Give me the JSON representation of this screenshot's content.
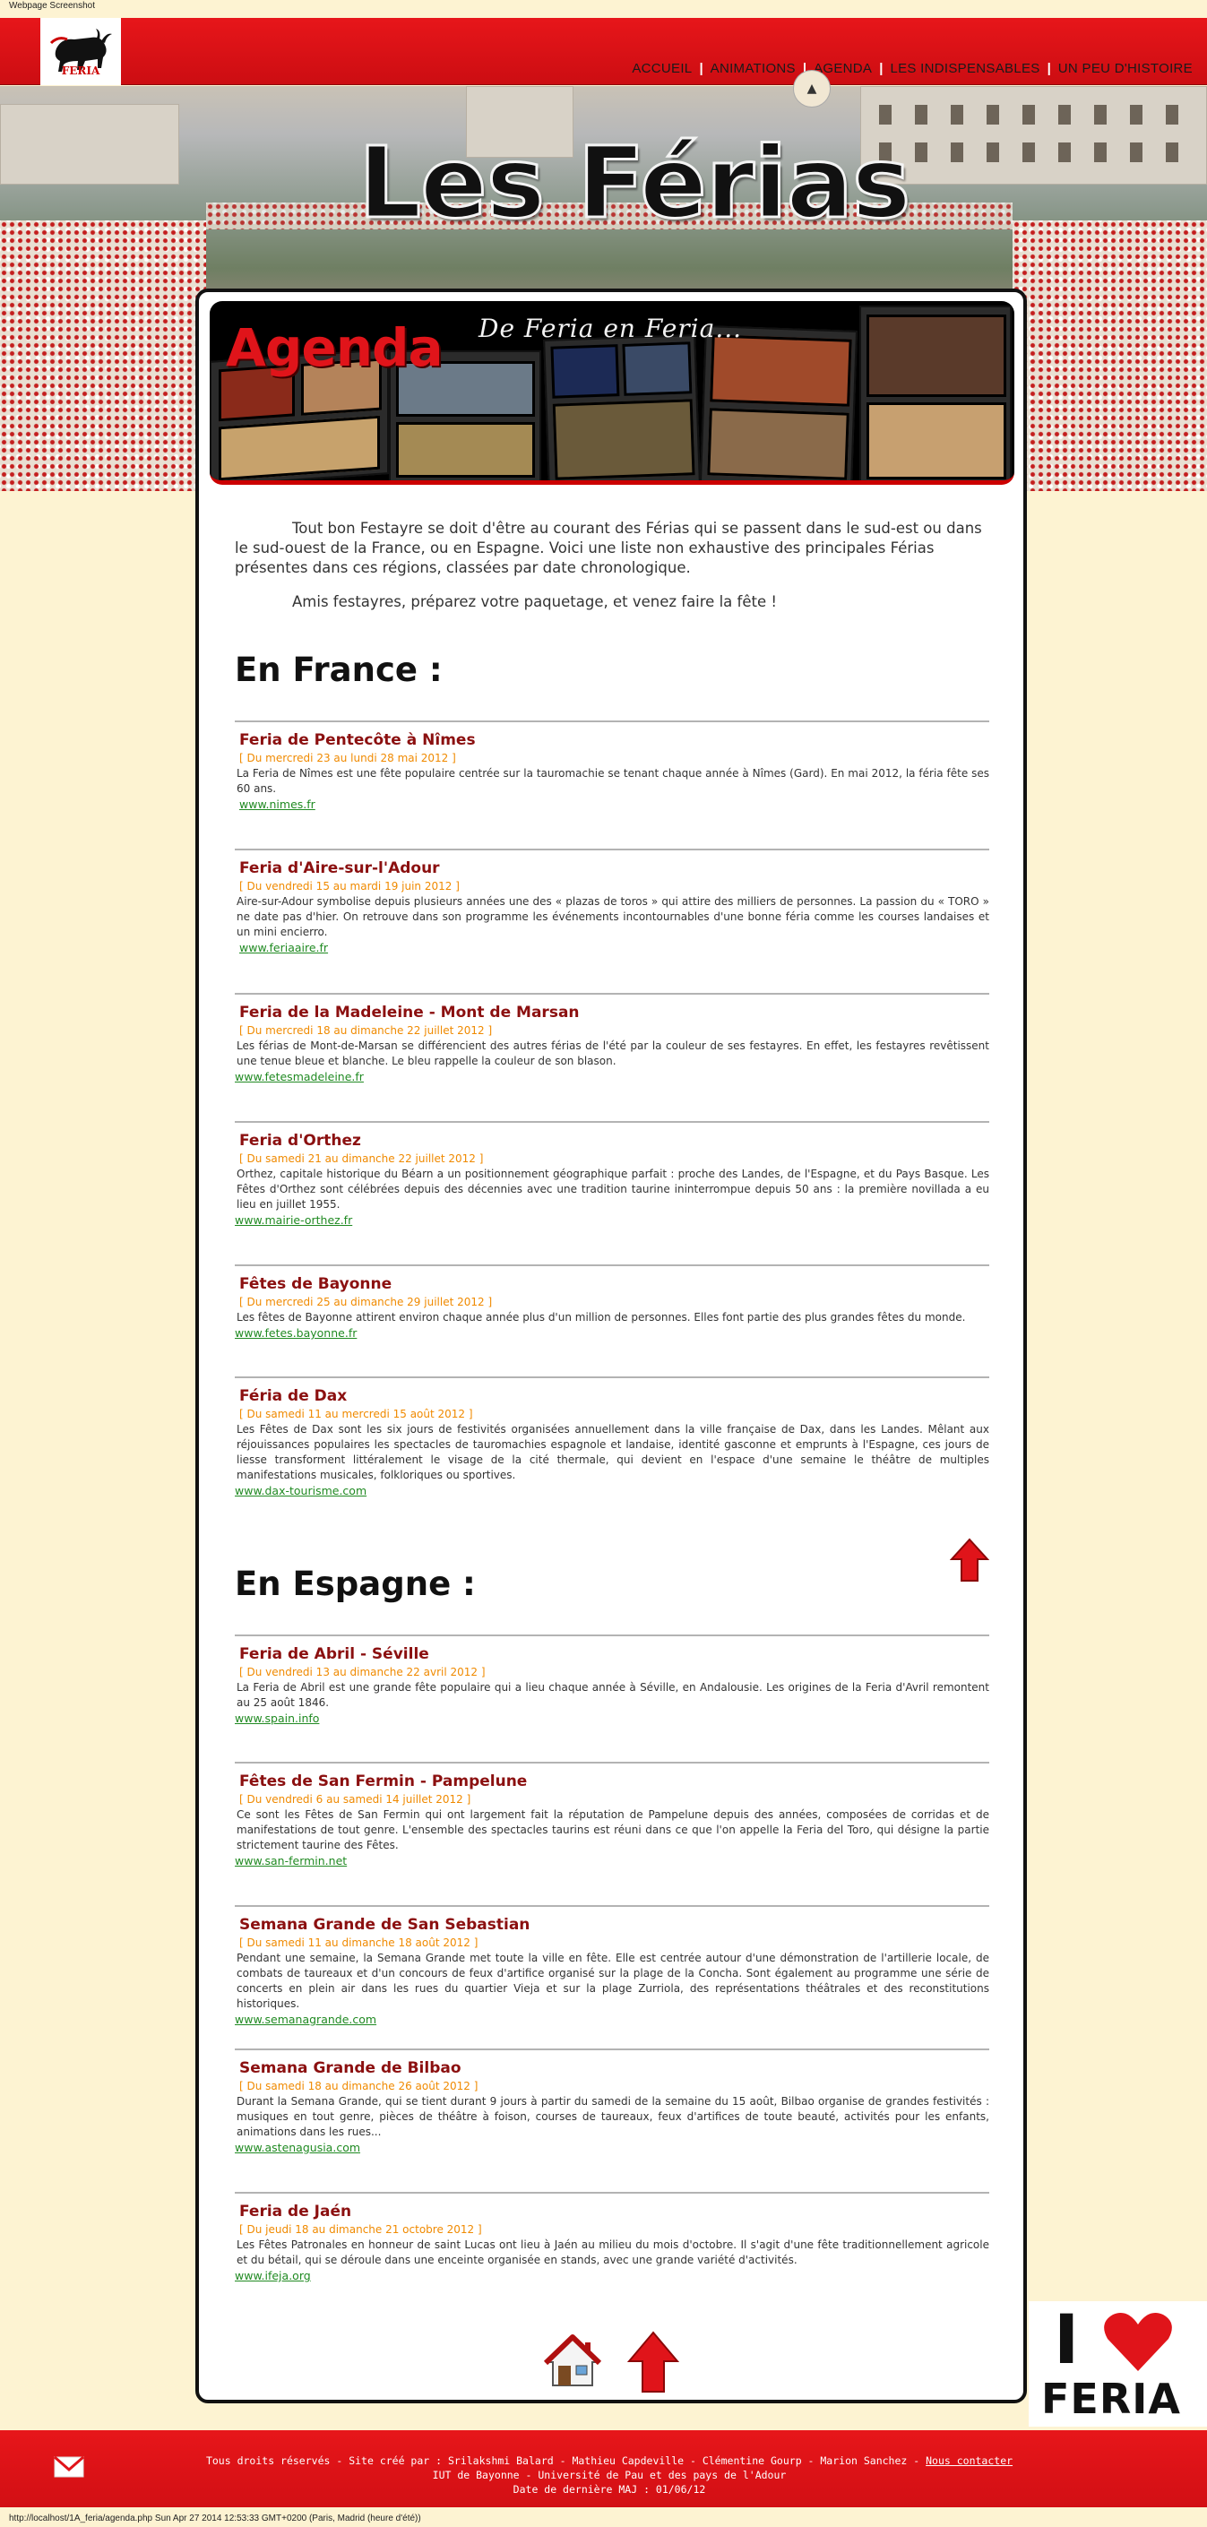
{
  "window": {
    "caption": "Webpage Screenshot",
    "status_url": "http://localhost/1A_feria/agenda.php Sun Apr 27 2014 12:53:33 GMT+0200 (Paris, Madrid (heure d'été))"
  },
  "header": {
    "logo_text": "FERIA",
    "nav": [
      "ACCUEIL",
      "ANIMATIONS",
      "AGENDA",
      "LES INDISPENSABLES",
      "UN PEU D'HISTOIRE"
    ],
    "nav_separator": "|",
    "active_nav": "AGENDA",
    "indicator_glyph": "▲"
  },
  "banner": {
    "title": "Les Férias"
  },
  "agenda_banner": {
    "title": "Agenda",
    "subtitle": "De Feria en Feria..."
  },
  "intro": {
    "paragraph1": "Tout bon Festayre se doit d'être au courant des Férias qui se passent dans le sud-est ou dans le sud-ouest de la France, ou en Espagne. Voici une liste non exhaustive des principales Férias présentes dans ces régions, classées par date chronologique.",
    "paragraph2": "Amis festayres, préparez votre paquetage, et venez faire la fête !"
  },
  "france": {
    "heading": "En France :",
    "events": [
      {
        "title": "Feria de Pentecôte à Nîmes",
        "date": "[ Du mercredi 23 au lundi 28 mai 2012 ]",
        "description": "La Feria de Nîmes est une fête populaire centrée sur la tauromachie se tenant chaque année à Nîmes (Gard). En mai 2012, la féria fête ses 60 ans.",
        "link": "www.nimes.fr"
      },
      {
        "title": "Feria d'Aire-sur-l'Adour",
        "date": "[ Du vendredi 15 au mardi 19 juin 2012 ]",
        "description": "Aire-sur-Adour symbolise depuis plusieurs années une des « plazas de toros » qui attire des milliers de personnes. La passion du « TORO » ne date pas d'hier. On retrouve dans son programme les événements incontournables d'une bonne féria comme les courses landaises et un mini encierro.",
        "link": "www.feriaaire.fr"
      },
      {
        "title": "Feria de la Madeleine - Mont de Marsan",
        "date": "[ Du mercredi 18 au dimanche 22 juillet 2012 ]",
        "description": "Les férias de Mont-de-Marsan se différencient des autres férias de l'été par la couleur de ses festayres. En effet, les festayres revêtissent une tenue bleue et blanche. Le bleu rappelle la couleur de son blason.",
        "link": "www.fetesmadeleine.fr"
      },
      {
        "title": "Feria d'Orthez",
        "date": "[ Du samedi 21 au dimanche 22 juillet 2012 ]",
        "description": "Orthez, capitale historique du Béarn a un positionnement géographique parfait : proche des Landes, de l'Espagne, et du Pays Basque. Les Fêtes d'Orthez sont célébrées depuis des décennies avec une tradition taurine ininterrompue depuis 50 ans : la première novillada a eu lieu en juillet 1955.",
        "link": "www.mairie-orthez.fr"
      },
      {
        "title": "Fêtes de Bayonne",
        "date": "[ Du mercredi 25 au dimanche 29 juillet 2012 ]",
        "description": "Les fêtes de Bayonne attirent environ chaque année plus d'un million de personnes. Elles font partie des plus grandes fêtes du monde.",
        "link": "www.fetes.bayonne.fr"
      },
      {
        "title": "Féria de Dax",
        "date": "[ Du samedi 11 au mercredi 15 août 2012 ]",
        "description": "Les Fêtes de Dax sont les six jours de festivités organisées annuellement dans la ville française de Dax, dans les Landes. Mêlant aux réjouissances populaires les spectacles de tauromachies espagnole et landaise, identité gasconne et emprunts à l'Espagne, ces jours de liesse transforment littéralement le visage de la cité thermale, qui devient en l'espace d'une semaine le théâtre de multiples manifestations musicales, folkloriques ou sportives.",
        "link": "www.dax-tourisme.com"
      }
    ]
  },
  "spain": {
    "heading": "En Espagne :",
    "events": [
      {
        "title": "Feria de Abril - Séville",
        "date": "[ Du vendredi 13 au dimanche 22 avril 2012 ]",
        "description": "La Feria de Abril est une grande fête populaire qui a lieu chaque année à Séville, en Andalousie. Les origines de la Feria d'Avril remontent au 25 août 1846.",
        "link": "www.spain.info"
      },
      {
        "title": "Fêtes de San Fermin - Pampelune",
        "date": "[ Du vendredi 6 au samedi 14 juillet 2012 ]",
        "description": "Ce sont les Fêtes de San Fermin qui ont largement fait la réputation de Pampelune depuis des années, composées de corridas et de manifestations de tout genre. L'ensemble des spectacles taurins est réuni dans ce que l'on appelle la Feria del Toro, qui désigne la partie strictement taurine des Fêtes.",
        "link": "www.san-fermin.net"
      },
      {
        "title": "Semana Grande de San Sebastian",
        "date": "[ Du samedi 11 au dimanche 18 août 2012 ]",
        "description": "Pendant une semaine, la Semana Grande met toute la ville en fête. Elle est centrée autour d'une démonstration de l'artillerie locale, de combats de taureaux et d'un concours de feux d'artifice organisé sur la plage de la Concha. Sont également au programme une série de concerts en plein air dans les rues du quartier Vieja et sur la plage Zurriola, des représentations théâtrales et des reconstitutions historiques.",
        "link": "www.semanagrande.com"
      },
      {
        "title": "Semana Grande de Bilbao",
        "date": "[ Du samedi 18 au dimanche 26 août 2012 ]",
        "description": "Durant la Semana Grande, qui se tient durant 9 jours à partir du samedi de la semaine du 15 août, Bilbao organise de grandes festivités : musiques en tout genre, pièces de théâtre à foison, courses de taureaux, feux d'artifices de toute beauté, activités pour les enfants, animations dans les rues...",
        "link": "www.astenagusia.com"
      },
      {
        "title": "Feria de Jaén",
        "date": "[ Du jeudi 18 au dimanche 21 octobre 2012 ]",
        "description": "Les Fêtes Patronales en honneur de saint Lucas ont lieu à Jaén au milieu du mois d'octobre. Il s'agit d'une fête traditionnellement agricole et du bétail, qui se déroule dans une enceinte organisée en stands, avec une grande variété d'activités.",
        "link": "www.ifeja.org"
      }
    ]
  },
  "badge": {
    "letter": "I",
    "word": "FERIA"
  },
  "footer": {
    "line1_prefix": "Tous droits réservés - Site créé par : Srilakshmi Balard - Mathieu Capdeville - Clémentine Gourp - Marion Sanchez -",
    "contact_label": "Nous contacter",
    "line2": "IUT de Bayonne - Université de Pau et des pays de l'Adour",
    "line3": "Date de dernière MAJ : 01/06/12"
  },
  "colors": {
    "brand_red": "#e0141a",
    "event_title": "#8b1010",
    "event_date": "#f08a00",
    "event_link": "#208a22",
    "page_bg": "#fdf3d2"
  }
}
